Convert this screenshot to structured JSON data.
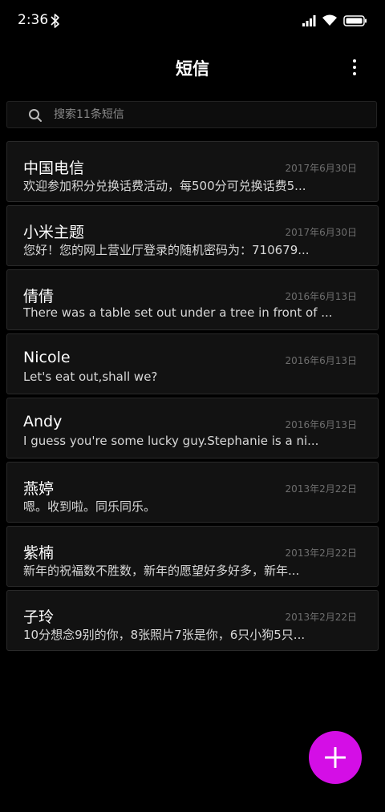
{
  "status_bar": {
    "time": "2:36",
    "icons": [
      "bluetooth-icon",
      "signal-icon",
      "wifi-icon",
      "battery-icon"
    ]
  },
  "header": {
    "title": "短信",
    "more_icon": "more-vertical-icon"
  },
  "search": {
    "placeholder": "搜索11条短信",
    "icon": "search-icon"
  },
  "messages": [
    {
      "sender": "中国电信",
      "date": "2017年6月30日",
      "preview": "欢迎参加积分兑换话费活动，每500分可兑换话费5..."
    },
    {
      "sender": "小米主题",
      "date": "2017年6月30日",
      "preview": "您好！您的网上营业厅登录的随机密码为：710679..."
    },
    {
      "sender": "倩倩",
      "date": "2016年6月13日",
      "preview": "There was a table set out under a tree in front of ..."
    },
    {
      "sender": "Nicole",
      "date": "2016年6月13日",
      "preview": "Let's eat out,shall we?"
    },
    {
      "sender": "Andy",
      "date": "2016年6月13日",
      "preview": "I guess you're some lucky guy.Stephanie is a ni..."
    },
    {
      "sender": "燕婷",
      "date": "2013年2月22日",
      "preview": "嗯。收到啦。同乐同乐。"
    },
    {
      "sender": "紫楠",
      "date": "2013年2月22日",
      "preview": "新年的祝福数不胜数，新年的愿望好多好多，新年..."
    },
    {
      "sender": "子玲",
      "date": "2013年2月22日",
      "preview": "10分想念9别的你，8张照片7张是你，6只小狗5只..."
    }
  ],
  "fab": {
    "icon": "plus-icon",
    "color": "#d40ee6"
  },
  "colors": {
    "background": "#000000",
    "card": "#121212",
    "accent": "#d40ee6",
    "date_text": "#6e6e6e"
  }
}
